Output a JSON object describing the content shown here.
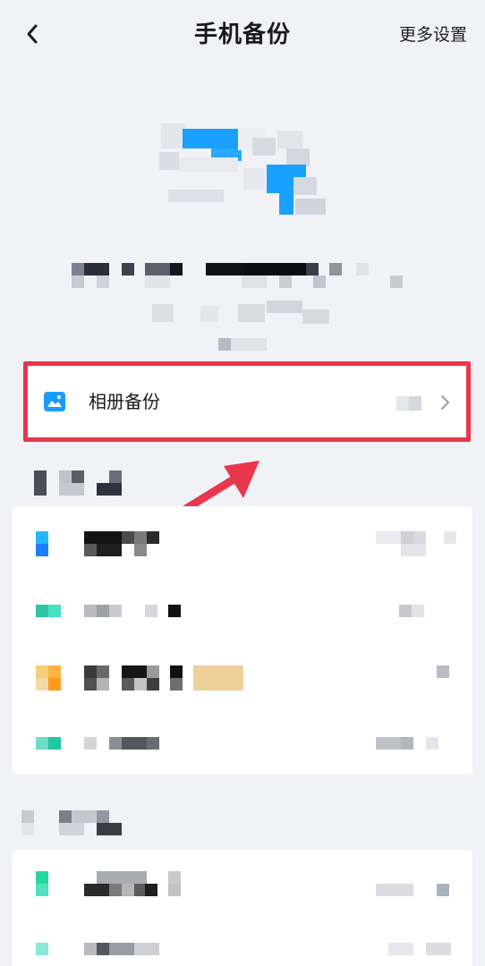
{
  "header": {
    "title": "手机备份",
    "more_settings": "更多设置"
  },
  "album_backup": {
    "label": "相册备份"
  },
  "colors": {
    "highlight_border": "#e8374b",
    "arrow": "#e8374b",
    "background": "#f1f2f7",
    "accent_blue": "#1a9bff"
  },
  "icons": {
    "back": "chevron-left-icon",
    "album": "photo-album-icon",
    "row_chevron": "chevron-right-icon",
    "arrow": "pointing-arrow"
  }
}
